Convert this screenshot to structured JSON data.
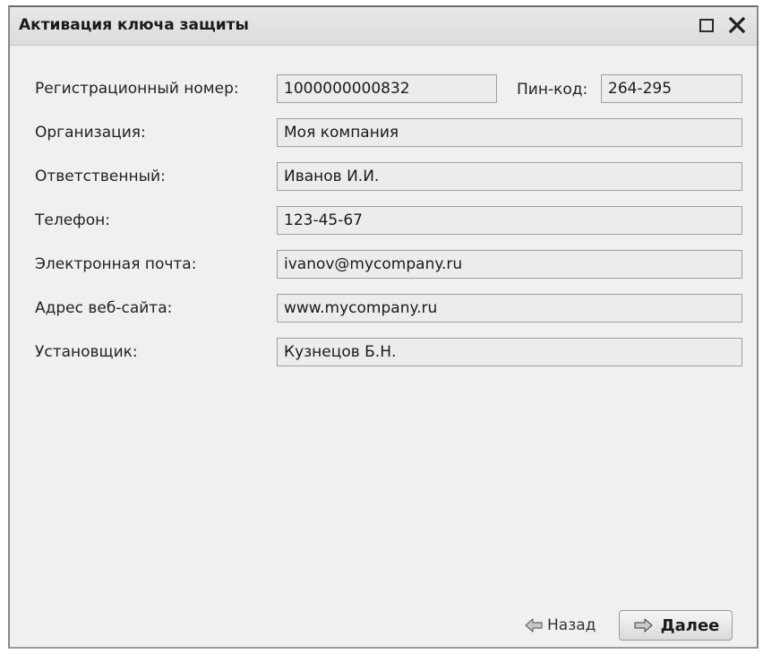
{
  "window": {
    "title": "Активация ключа защиты"
  },
  "form": {
    "reg_number": {
      "label": "Регистрационный номер:",
      "value": "1000000000832"
    },
    "pin": {
      "label": "Пин-код:",
      "value": "264-295"
    },
    "organization": {
      "label": "Организация:",
      "value": "Моя компания"
    },
    "responsible": {
      "label": "Ответственный:",
      "value": "Иванов И.И."
    },
    "phone": {
      "label": "Телефон:",
      "value": "123-45-67"
    },
    "email": {
      "label": "Электронная почта:",
      "value": "ivanov@mycompany.ru"
    },
    "website": {
      "label": "Адрес веб-сайта:",
      "value": "www.mycompany.ru"
    },
    "installer": {
      "label": "Установщик:",
      "value": "Кузнецов Б.Н."
    }
  },
  "footer": {
    "back_label": "Назад",
    "next_label": "Далее"
  },
  "icons": {
    "maximize": "maximize-icon",
    "close": "close-icon",
    "back": "arrow-left-icon",
    "next": "arrow-right-icon"
  }
}
